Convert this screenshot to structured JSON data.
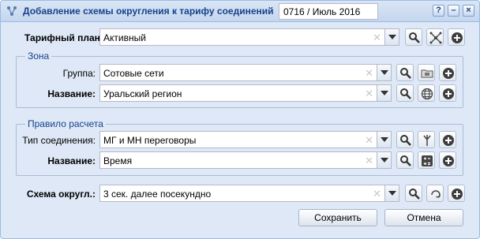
{
  "window": {
    "title": "Добавление схемы округления к тарифу соединений",
    "period": "0716 / Июль 2016",
    "help_label": "?",
    "minimize_label": "–",
    "close_label": "×"
  },
  "tariff_plan": {
    "label": "Тарифный план:",
    "value": "Активный"
  },
  "zone": {
    "legend": "Зона",
    "group": {
      "label": "Группа:",
      "value": "Сотовые сети"
    },
    "name": {
      "label": "Название:",
      "value": "Уральский регион"
    }
  },
  "rule": {
    "legend": "Правило расчета",
    "connection_type": {
      "label": "Тип соединения:",
      "value": "МГ и МН переговоры"
    },
    "name": {
      "label": "Название:",
      "value": "Время"
    }
  },
  "rounding_scheme": {
    "label": "Схема округл.:",
    "value": "3 сек. далее посекундно"
  },
  "buttons": {
    "save": "Сохранить",
    "cancel": "Отмена"
  },
  "colors": {
    "title_text": "#15428b",
    "window_bg": "#dfe8f6",
    "border": "#99bbe8"
  }
}
